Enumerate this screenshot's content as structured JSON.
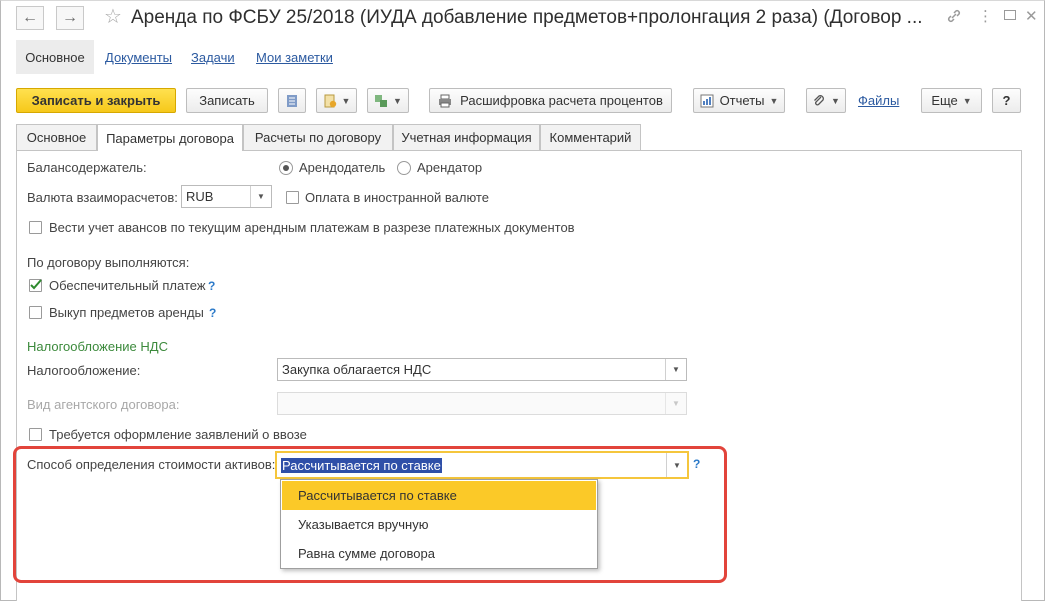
{
  "window": {
    "title": "Аренда по ФСБУ 25/2018 (ИУДА  добавление предметов+пролонгация 2 раза) (Договор ...",
    "nav_back": "←",
    "nav_forward": "→",
    "star": "☆",
    "link_icon": "🔗",
    "menu_icon": "⋮",
    "restore_icon": "▭",
    "close_icon": "✕"
  },
  "sections": {
    "main": "Основное",
    "documents": "Документы",
    "tasks": "Задачи",
    "notes": "Мои заметки"
  },
  "toolbar": {
    "save_close": "Записать и закрыть",
    "save": "Записать",
    "calc_decode": "Расшифровка расчета процентов",
    "reports": "Отчеты",
    "files": "Файлы",
    "more": "Еще",
    "help": "?"
  },
  "tabs": [
    {
      "label": "Основное"
    },
    {
      "label": "Параметры договора"
    },
    {
      "label": "Расчеты по договору"
    },
    {
      "label": "Учетная информация"
    },
    {
      "label": "Комментарий"
    }
  ],
  "form": {
    "holder_label": "Балансодержатель:",
    "holder_options": [
      "Арендодатель",
      "Арендатор"
    ],
    "holder_selected": "Арендодатель",
    "currency_label": "Валюта взаиморасчетов:",
    "currency_value": "RUB",
    "foreign_currency_label": "Оплата в иностранной валюте",
    "advances_label": "Вести учет авансов по текущим арендным платежам в разрезе платежных документов",
    "contract_performs_label": "По договору выполняются:",
    "security_payment_label": "Обеспечительный платеж",
    "security_payment_checked": true,
    "buyout_label": "Выкуп предметов аренды",
    "buyout_checked": false,
    "help_mark": "?",
    "vat_section": "Налогообложение НДС",
    "taxation_label": "Налогообложение:",
    "taxation_value": "Закупка облагается НДС",
    "agent_contract_label": "Вид агентского договора:",
    "agent_contract_value": "",
    "import_statements_label": "Требуется оформление заявлений о ввозе",
    "asset_cost_label": "Способ определения стоимости активов:",
    "asset_cost_value": "Рассчитывается по ставке",
    "asset_cost_options": [
      "Рассчитывается по ставке",
      "Указывается вручную",
      "Равна сумме договора"
    ],
    "asset_cost_highlighted": "Рассчитывается по ставке"
  },
  "colors": {
    "primary_button": "#f6c81a",
    "highlight_annotation": "#e2443b",
    "dropdown_highlight": "#fbc928",
    "link": "#2c5aa0",
    "section_green": "#3c8a3c"
  }
}
